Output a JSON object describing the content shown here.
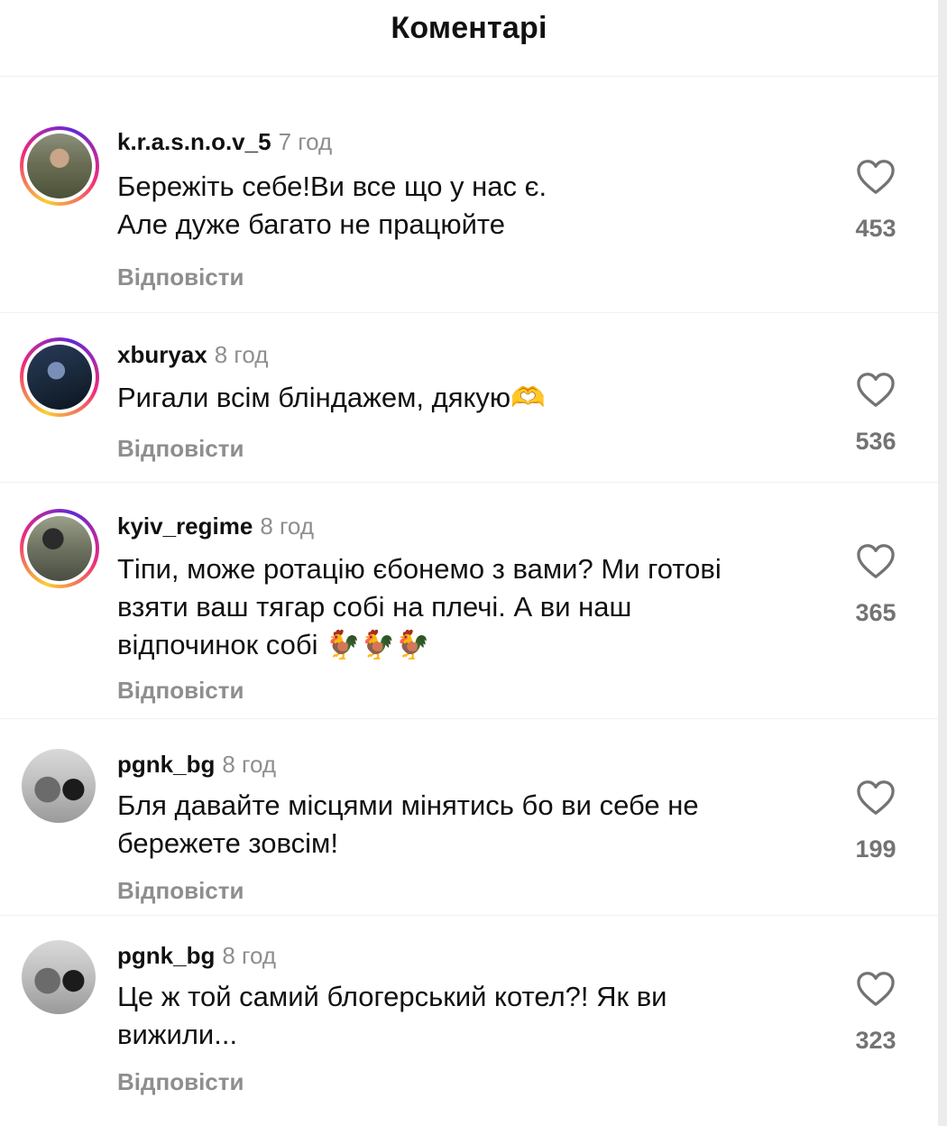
{
  "header": {
    "title": "Коментарі"
  },
  "reply_label": "Відповісти",
  "colors": {
    "username": "#111111",
    "muted": "#8e8e8e",
    "like_count": "#737373",
    "story_ring": [
      "#f9ce34",
      "#ee2a7b",
      "#6228d7"
    ]
  },
  "comments": [
    {
      "username": "k.r.a.s.n.o.v_5",
      "time": "7 год",
      "text": "Бережіть себе!Ви все що у нас є.\nАле дуже багато не працюйте",
      "likes": "453",
      "story_ring": true
    },
    {
      "username": "xburyax",
      "time": "8 год",
      "text": "Ригали всім бліндажем, дякую🫶",
      "likes": "536",
      "story_ring": true
    },
    {
      "username": "kyiv_regime",
      "time": "8 год",
      "text": "Тіпи, може ротацію єбонемо з вами? Ми готові\nвзяти ваш тягар собі на плечі. А ви наш\nвідпочинок собі 🐓🐓🐓",
      "likes": "365",
      "story_ring": true
    },
    {
      "username": "pgnk_bg",
      "time": "8 год",
      "text": "Бля давайте місцями мінятись бо ви себе не\nбережете зовсім!",
      "likes": "199",
      "story_ring": false
    },
    {
      "username": "pgnk_bg",
      "time": "8 год",
      "text": "Це ж той самий блогерський котел?! Як ви\nвижили...",
      "likes": "323",
      "story_ring": false
    }
  ]
}
